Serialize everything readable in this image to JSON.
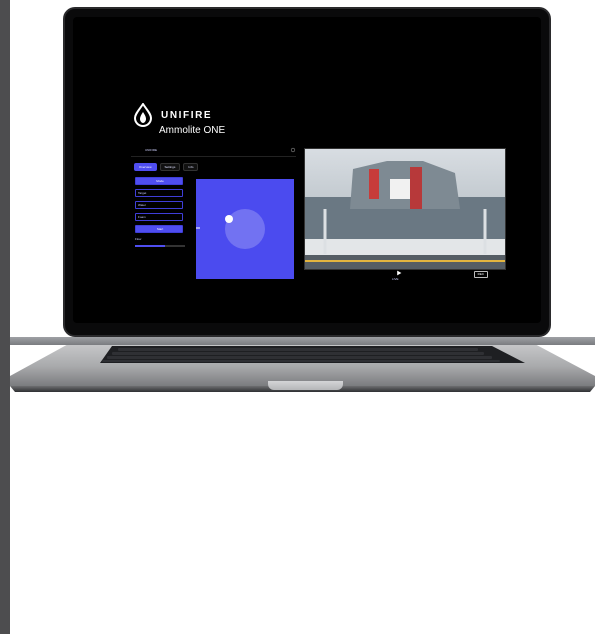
{
  "brand": {
    "name": "UNIFIRE",
    "product": "Ammolite ONE",
    "logo_icon": "flame-drop-icon"
  },
  "app": {
    "header_title": "UNIFIRE",
    "settings_icon": "gear-icon",
    "tabs": [
      {
        "label": "Overview"
      },
      {
        "label": "Settings"
      },
      {
        "label": "Info"
      }
    ],
    "controls": [
      {
        "label": "Mode"
      },
      {
        "label": "Target"
      },
      {
        "label": "Water"
      },
      {
        "label": "Foam"
      },
      {
        "label": "Start"
      }
    ],
    "slider_label": "Flow",
    "slider_value": 0.6,
    "play_label": "LIVE",
    "status_badge": "REC",
    "accent_color": "#4f4ef0"
  }
}
